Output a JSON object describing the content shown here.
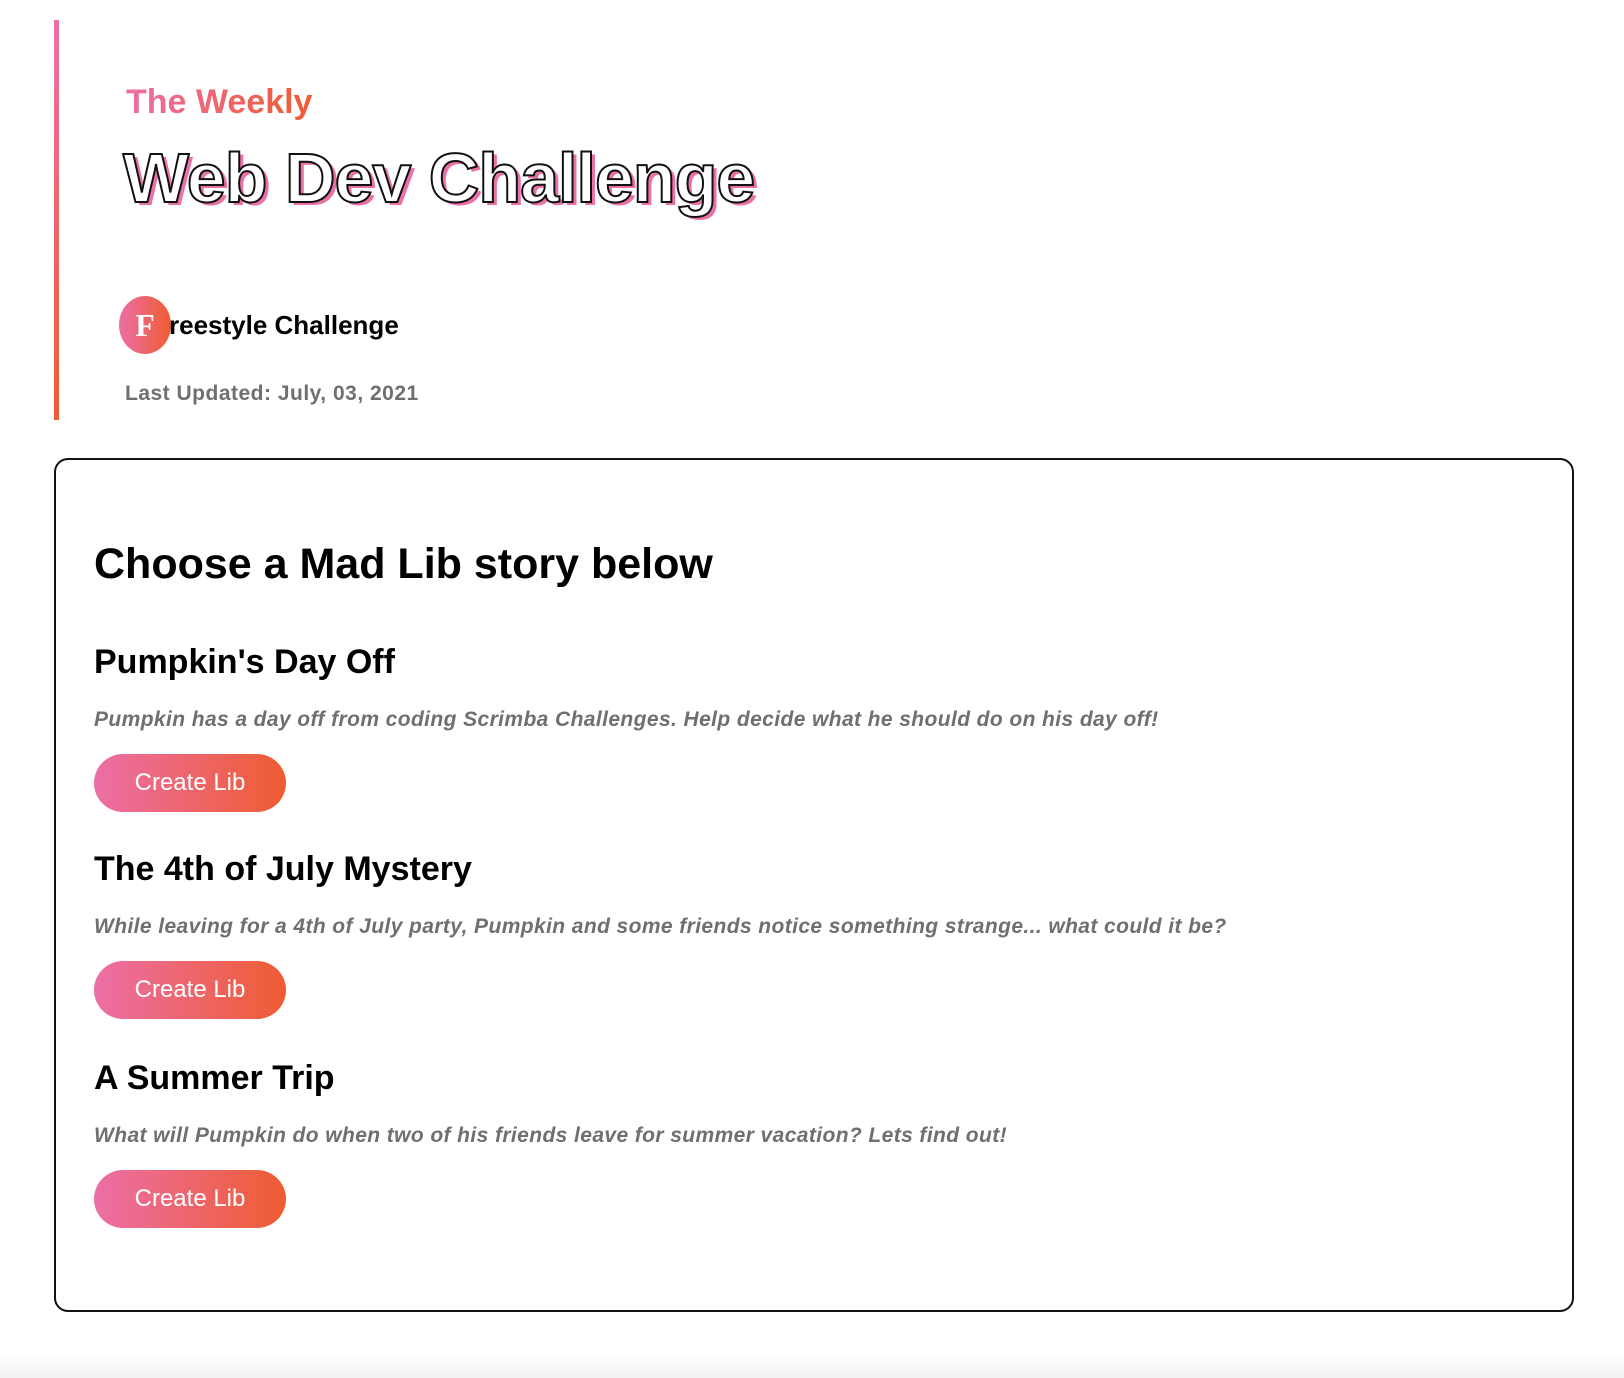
{
  "header": {
    "kicker": "The Weekly",
    "title": "Web Dev Challenge",
    "badge_letter": "F",
    "badge_rest": "reestyle Challenge",
    "last_updated": "Last Updated: July, 03, 2021"
  },
  "main": {
    "heading": "Choose a Mad Lib story below",
    "stories": [
      {
        "title": "Pumpkin's Day Off",
        "description": "Pumpkin has a day off from coding Scrimba Challenges. Help decide what he should do on his day off!",
        "button_label": "Create Lib"
      },
      {
        "title": "The 4th of July Mystery",
        "description": "While leaving for a 4th of July party, Pumpkin and some friends notice something strange... what could it be?",
        "button_label": "Create Lib"
      },
      {
        "title": "A Summer Trip",
        "description": "What will Pumpkin do when two of his friends leave for summer vacation? Lets find out!",
        "button_label": "Create Lib"
      }
    ]
  },
  "colors": {
    "gradient_start": "#ec6fa6",
    "gradient_end": "#ee5c32",
    "muted_text": "#6f6f6f"
  }
}
